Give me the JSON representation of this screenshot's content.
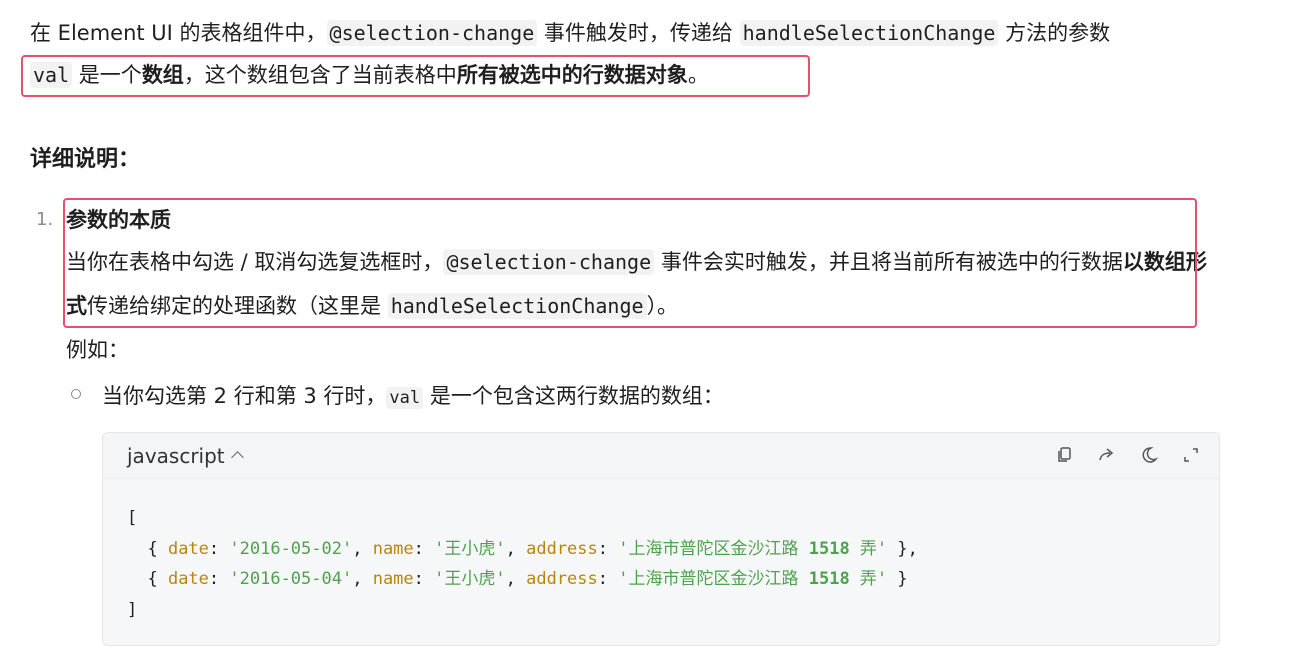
{
  "intro": {
    "part1": "在 Element UI 的表格组件中，",
    "event_code": "@selection-change",
    "part2": " 事件触发时，传递给 ",
    "method_code": "handleSelectionChange",
    "part3": " 方法的参数",
    "val_code": "val",
    "part4": " 是一个",
    "bold_array": "数组",
    "part5": "，这个数组包含了当前表格中",
    "bold_rows": "所有被选中的行数据对象",
    "part6": "。"
  },
  "section_heading": "详细说明：",
  "list": {
    "number": "1.",
    "title": "参数的本质",
    "body_part1": "当你在表格中勾选 / 取消勾选复选框时，",
    "body_event_code": "@selection-change",
    "body_part2": " 事件会实时触发，并且将当前所有被选中的行数据",
    "body_bold": "以数组形式",
    "body_part3": "传递给绑定的处理函数（这里是 ",
    "body_method_code": "handleSelectionChange",
    "body_part4": "）。",
    "example_label": "例如：",
    "bullet_part1": "当你勾选第 2 行和第 3 行时，",
    "bullet_code": "val",
    "bullet_part2": " 是一个包含这两行数据的数组："
  },
  "code_block": {
    "language": "javascript",
    "icons": [
      "copy-icon",
      "share-icon",
      "theme-moon-icon",
      "expand-icon"
    ],
    "lines": {
      "open": "[",
      "close": "]"
    },
    "rows": [
      {
        "date_key": "date",
        "date_val": "'2016-05-02'",
        "name_key": "name",
        "name_val": "'王小虎'",
        "addr_key": "address",
        "addr_val_a": "'上海市普陀区金沙江路 ",
        "addr_num": "1518",
        "addr_val_b": " 弄'",
        "tail": " },"
      },
      {
        "date_key": "date",
        "date_val": "'2016-05-04'",
        "name_key": "name",
        "name_val": "'王小虎'",
        "addr_key": "address",
        "addr_val_a": "'上海市普陀区金沙江路 ",
        "addr_num": "1518",
        "addr_val_b": " 弄'",
        "tail": " }"
      }
    ]
  },
  "colors": {
    "highlight_border": "#e8516b",
    "code_key": "#b8860b",
    "code_string": "#50a14f"
  }
}
